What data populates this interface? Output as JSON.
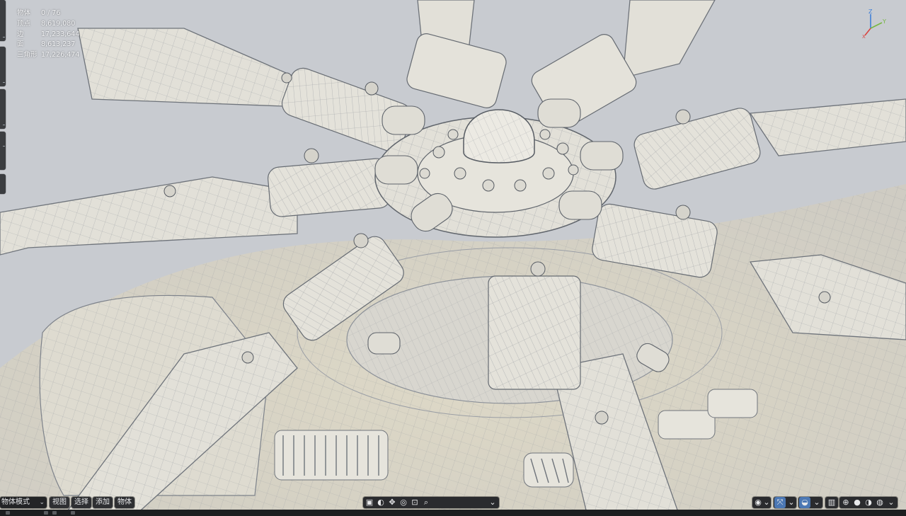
{
  "stats": [
    {
      "key": "物体",
      "value": "0 / 76"
    },
    {
      "key": "顶点",
      "value": "8,619,080"
    },
    {
      "key": "边",
      "value": "17,233,644"
    },
    {
      "key": "面",
      "value": "8,613,237"
    },
    {
      "key": "三角形",
      "value": "17,226,474"
    }
  ],
  "gizmo": {
    "z": "Z",
    "y": "Y",
    "x": "X"
  },
  "header": {
    "mode": "物体模式",
    "menus": [
      "视图",
      "选择",
      "添加",
      "物体"
    ]
  },
  "icons": {
    "select_box": "select-box-icon",
    "cursor": "cursor-icon",
    "move": "move-icon",
    "rotate": "rotate-icon",
    "scale": "scale-icon",
    "search": "search-icon"
  },
  "colors": {
    "viewport_bg": "#c9ccd1",
    "model": "#e3e1d9",
    "wire": "#7d828a",
    "active": "#4b77b3"
  }
}
